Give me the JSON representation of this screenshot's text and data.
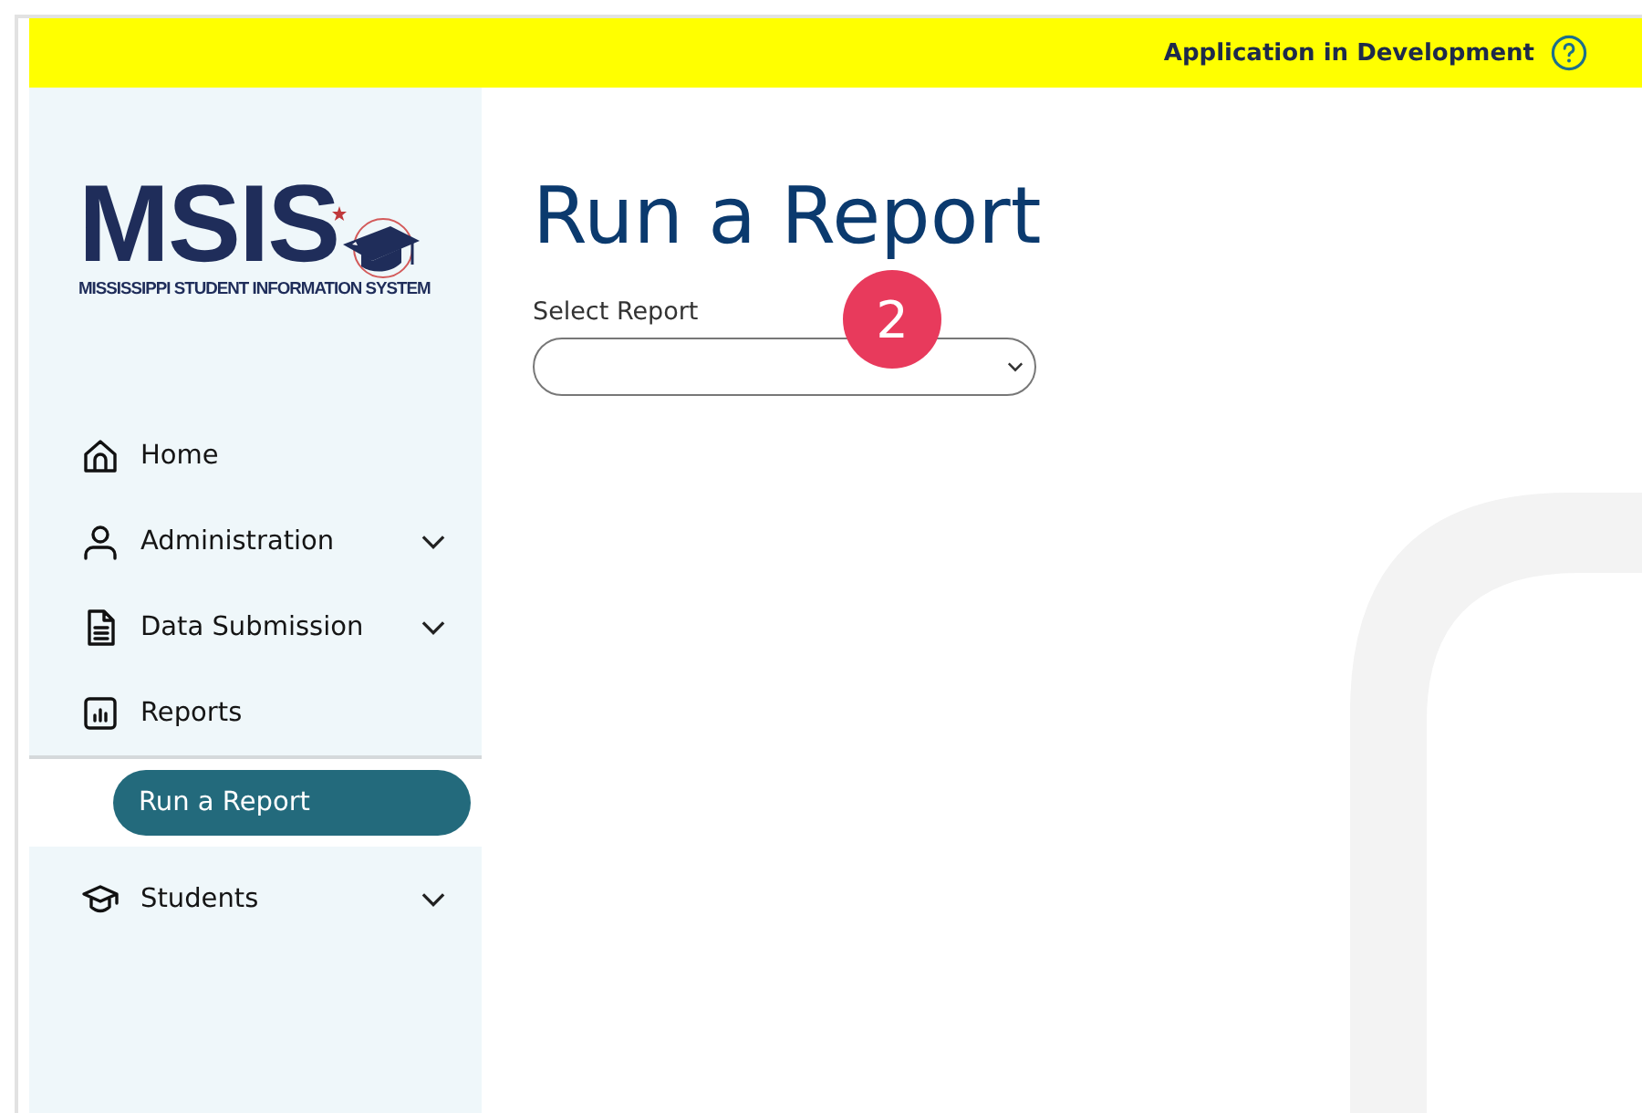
{
  "banner": {
    "text": "Application in Development"
  },
  "logo": {
    "wordmark": "MSIS",
    "tagline": "MISSISSIPPI STUDENT INFORMATION SYSTEM"
  },
  "sidebar": {
    "items": [
      {
        "label": "Home"
      },
      {
        "label": "Administration",
        "expanded": false
      },
      {
        "label": "Data Submission",
        "expanded": false
      },
      {
        "label": "Reports",
        "expanded": true,
        "children": [
          {
            "label": "Run a Report",
            "selected": true
          }
        ]
      },
      {
        "label": "Students",
        "expanded": false
      }
    ]
  },
  "main": {
    "title": "Run a Report",
    "select_label": "Select Report",
    "step_badge": "2"
  }
}
